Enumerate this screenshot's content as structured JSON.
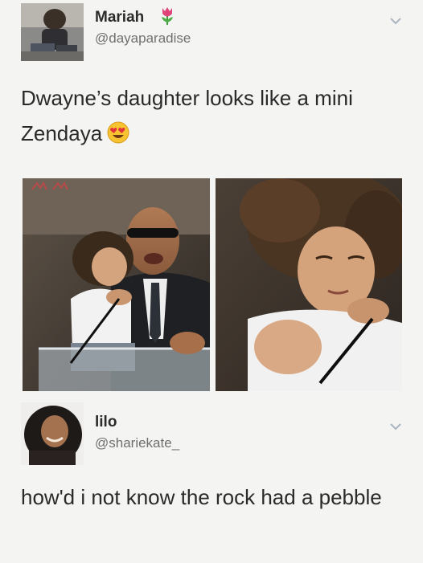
{
  "tweet1": {
    "name": "Mariah",
    "handle": "@dayaparadise",
    "text": "Dwayne’s daughter looks like a mini Zendaya",
    "name_emoji": "tulip-icon",
    "text_emoji": "heart-eyes-emoji-icon"
  },
  "tweet2": {
    "name": "lilo",
    "handle": "@shariekate_",
    "text": "how'd i not know the rock had a pebble"
  },
  "colors": {
    "background": "#f4f4f2",
    "text": "#2a2a2a",
    "handle": "#6f6f6f",
    "chevron": "#a9b4be"
  }
}
